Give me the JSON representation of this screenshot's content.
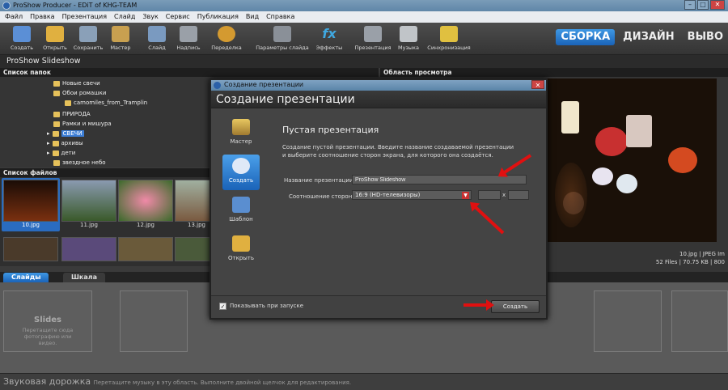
{
  "window": {
    "title": "ProShow Producer - EDiT of KHG-TEAM",
    "controls": [
      "–",
      "□",
      "✕"
    ]
  },
  "menu": [
    "Файл",
    "Правка",
    "Презентация",
    "Слайд",
    "Звук",
    "Сервис",
    "Публикация",
    "Вид",
    "Справка"
  ],
  "toolbar": [
    {
      "label": "Создать",
      "icon": "new-show-icon",
      "color": "#5b8fd6"
    },
    {
      "label": "Открыть",
      "icon": "open-folder-icon",
      "color": "#e0b040"
    },
    {
      "label": "Сохранить",
      "icon": "save-disk-icon",
      "color": "#8aa0b8"
    },
    {
      "label": "Мастер",
      "icon": "wizard-icon",
      "color": "#c8a050"
    },
    {
      "label": "Слайд",
      "icon": "add-slide-icon",
      "color": "#7a9ac0"
    },
    {
      "label": "Надпись",
      "icon": "caption-icon",
      "color": "#9aa0a8"
    },
    {
      "label": "Переделка",
      "icon": "remix-icon",
      "color": "#d49a30"
    },
    {
      "label": "Параметры слайда",
      "icon": "slide-options-icon",
      "color": "#8a9098"
    },
    {
      "label": "Эффекты",
      "icon": "effects-fx-icon",
      "color": "#40a8e0"
    },
    {
      "label": "Презентация",
      "icon": "show-options-icon",
      "color": "#9aa0a8"
    },
    {
      "label": "Музыка",
      "icon": "music-icon",
      "color": "#c0c4c8"
    },
    {
      "label": "Синхронизация",
      "icon": "sync-icon",
      "color": "#e0c040"
    }
  ],
  "modes": [
    {
      "label": "СБОРКА",
      "active": true
    },
    {
      "label": "ДИЗАЙН",
      "active": false
    },
    {
      "label": "ВЫВО",
      "active": false
    }
  ],
  "project_title": "ProShow Slideshow",
  "folders_panel": {
    "header": "Список папок",
    "items": [
      "Новые свечи",
      "Обои ромашки",
      "camomiles_from_Tramplin",
      "ПРИРОДА",
      "Рамки и мишура",
      "СВЕЧИ",
      "архивы",
      "дети",
      "звездное небо"
    ],
    "selected": "СВЕЧИ"
  },
  "preview_panel": {
    "header": "Область просмотра",
    "file_info": "10.jpg | JPEG Im",
    "stats": "52 Files | 70.75 KB | 800"
  },
  "files_panel": {
    "header": "Список файлов",
    "files": [
      "10.jpg",
      "11.jpg",
      "12.jpg",
      "13.jpg"
    ]
  },
  "lower_tabs": [
    {
      "label": "Слайды",
      "active": true
    },
    {
      "label": "Шкала",
      "active": false
    }
  ],
  "slides_area": {
    "title": "Slides",
    "hint": "Перетащите сюда фотографию или видео."
  },
  "audio_track": {
    "title": "Звуковая дорожка",
    "hint": "Перетащите музыку в эту область. Выполните двойной щелчок для редактирования."
  },
  "dialog": {
    "window_title": "Создание презентации",
    "header": "Создание презентации",
    "sidebar": [
      {
        "label": "Мастер",
        "icon": "wizard-hat-icon",
        "active": false
      },
      {
        "label": "Создать",
        "icon": "create-show-icon",
        "active": true
      },
      {
        "label": "Шаблон",
        "icon": "template-icon",
        "active": false
      },
      {
        "label": "Открыть",
        "icon": "open-folder-icon",
        "active": false
      }
    ],
    "heading": "Пустая презентация",
    "description": "Создание пустой презентации. Введите название создаваемой презентации и выберите соотношение сторон экрана, для которого она создаётся.",
    "name_label": "Название презентации",
    "name_value": "ProShow Slideshow",
    "aspect_label": "Соотношение сторон",
    "aspect_value": "16:9 (HD-телевизоры)",
    "custom_x_symbol": "x",
    "show_on_start_label": "Показывать при запуске",
    "show_on_start_checked": true,
    "create_button": "Создать"
  },
  "accent": "#2a7fd8"
}
